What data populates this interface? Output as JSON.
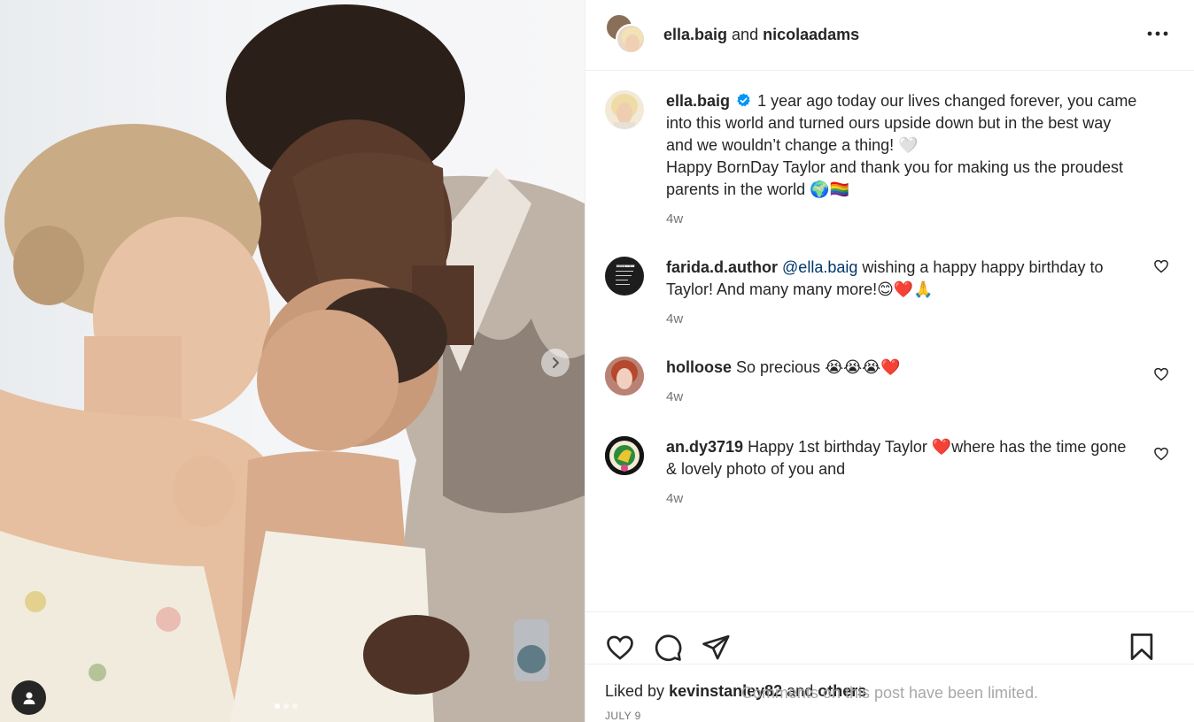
{
  "header": {
    "user1": "ella.baig",
    "connector": "and",
    "user2": "nicolaadams"
  },
  "caption": {
    "username": "ella.baig",
    "text_line1": "1 year ago today our lives changed forever, you came into this world and turned ours upside down but in the best way and we wouldn’t change a thing! 🤍",
    "text_line2": "Happy BornDay Taylor and thank you for making us the proudest parents in the world 🌍🏳️‍🌈",
    "time": "4w"
  },
  "comments": [
    {
      "username": "farida.d.author",
      "mention": "@ella.baig",
      "text": "wishing a happy happy birthday to Taylor! And many many more!😊❤️🙏",
      "time": "4w"
    },
    {
      "username": "holloose",
      "mention": "",
      "text": "So precious 😭😭😭❤️",
      "time": "4w"
    },
    {
      "username": "an.dy3719",
      "mention": "",
      "text": "Happy 1st birthday Taylor ❤️where has the time gone & lovely photo of you and",
      "time": "4w"
    }
  ],
  "likes": {
    "prefix": "Liked by",
    "user": "kevinstanley82",
    "connector": "and",
    "others": "others"
  },
  "date": "JULY 9",
  "limited_notice": "Comments on this post have been limited.",
  "farida_avatar_text": "-THE LIST -OF SHIT -THAT MADE -ME A -FEMINIST",
  "icons": {
    "more": "more-icon",
    "like": "heart-icon",
    "comment": "comment-icon",
    "share": "share-icon",
    "save": "bookmark-icon",
    "next": "chevron-right-icon",
    "tag": "user-tag-icon",
    "verified": "verified-badge-icon"
  },
  "colors": {
    "verified": "#0095f6",
    "link": "#00376b",
    "muted": "#737373"
  },
  "carousel": {
    "slide_count": 3,
    "active_index": 0
  }
}
